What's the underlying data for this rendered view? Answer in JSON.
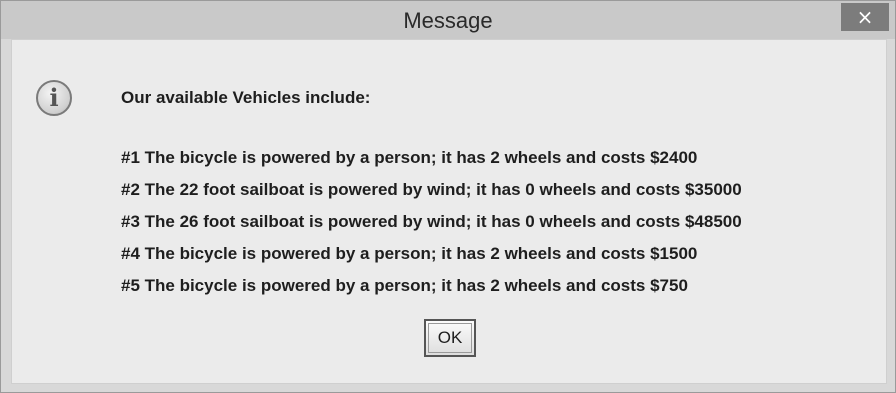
{
  "dialog": {
    "title": "Message",
    "close_glyph": "×",
    "icon": "information-icon",
    "heading": "Our available Vehicles include:",
    "vehicles": [
      "#1 The bicycle is powered by a person; it has 2 wheels and costs $2400",
      "#2 The 22 foot sailboat is powered by wind; it has 0 wheels and costs $35000",
      "#3 The 26 foot sailboat is powered by wind; it has 0 wheels and costs $48500",
      "#4 The bicycle is powered by a person; it has 2 wheels and costs $1500",
      "#5 The bicycle is powered by a person; it has 2 wheels and costs $750"
    ],
    "ok_label": "OK"
  }
}
